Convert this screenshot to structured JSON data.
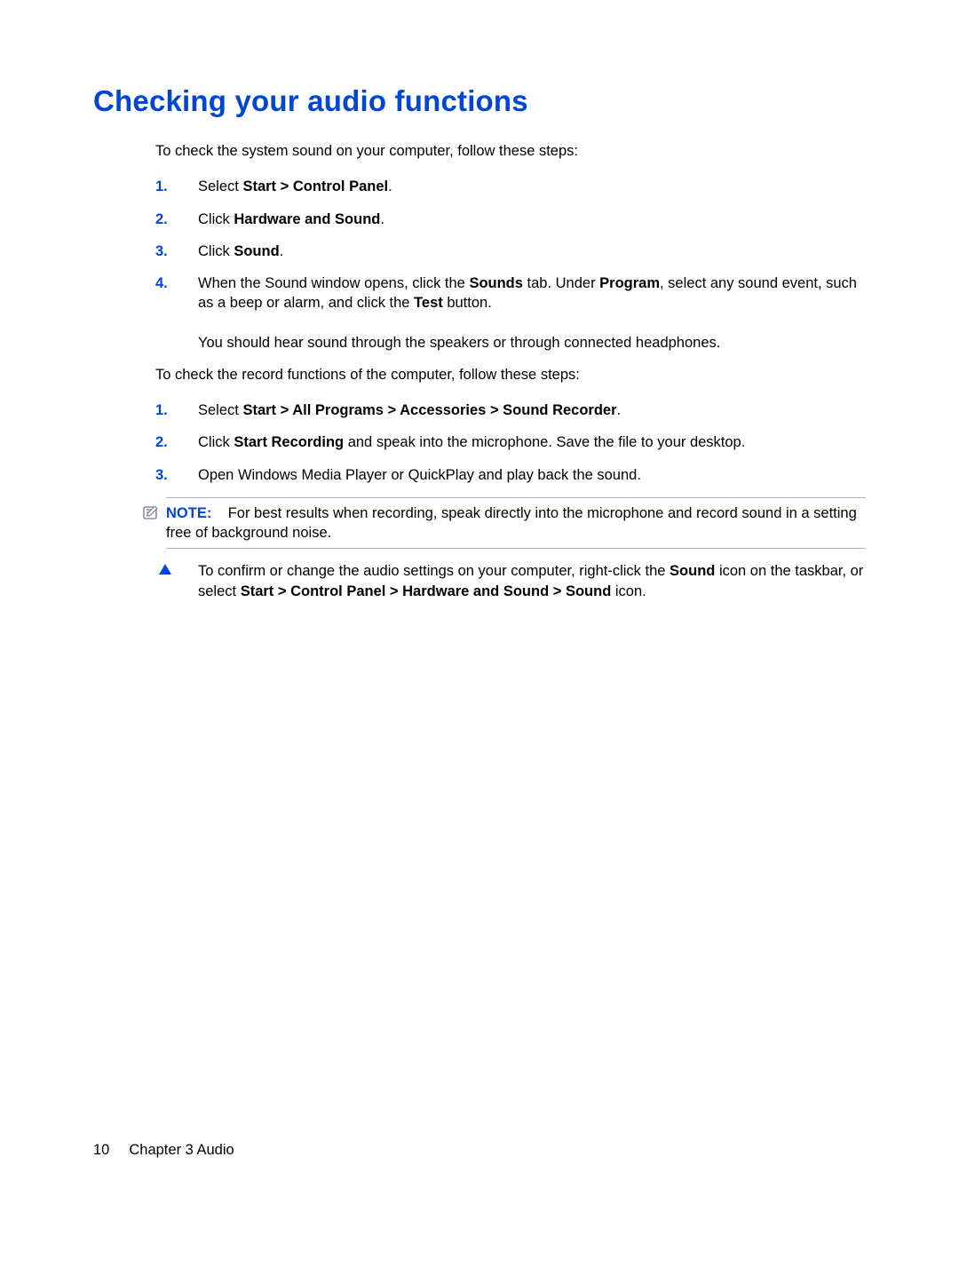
{
  "heading": "Checking your audio functions",
  "intro1": "To check the system sound on your computer, follow these steps:",
  "list1": {
    "step1": {
      "num": "1.",
      "pre": "Select ",
      "bold": "Start > Control Panel",
      "post": "."
    },
    "step2": {
      "num": "2.",
      "pre": "Click ",
      "bold": "Hardware and Sound",
      "post": "."
    },
    "step3": {
      "num": "3.",
      "pre": "Click ",
      "bold": "Sound",
      "post": "."
    },
    "step4": {
      "num": "4.",
      "p1_a": "When the Sound window opens, click the ",
      "p1_b": "Sounds",
      "p1_c": " tab. Under ",
      "p1_d": "Program",
      "p1_e": ", select any sound event, such as a beep or alarm, and click the ",
      "p1_f": "Test",
      "p1_g": " button.",
      "p2": "You should hear sound through the speakers or through connected headphones."
    }
  },
  "intro2": "To check the record functions of the computer, follow these steps:",
  "list2": {
    "step1": {
      "num": "1.",
      "pre": "Select ",
      "bold": "Start > All Programs > Accessories > Sound Recorder",
      "post": "."
    },
    "step2": {
      "num": "2.",
      "pre": "Click ",
      "bold": "Start Recording",
      "post": " and speak into the microphone. Save the file to your desktop."
    },
    "step3": {
      "num": "3.",
      "text": "Open Windows Media Player or QuickPlay and play back the sound."
    }
  },
  "note": {
    "label": "NOTE:",
    "text": "For best results when recording, speak directly into the microphone and record sound in a setting free of background noise."
  },
  "bullet": {
    "a": "To confirm or change the audio settings on your computer, right-click the ",
    "b": "Sound",
    "c": " icon on the taskbar, or select ",
    "d": "Start > Control Panel > Hardware and Sound > Sound",
    "e": " icon."
  },
  "footer": {
    "page": "10",
    "chapter": "Chapter 3   Audio"
  }
}
